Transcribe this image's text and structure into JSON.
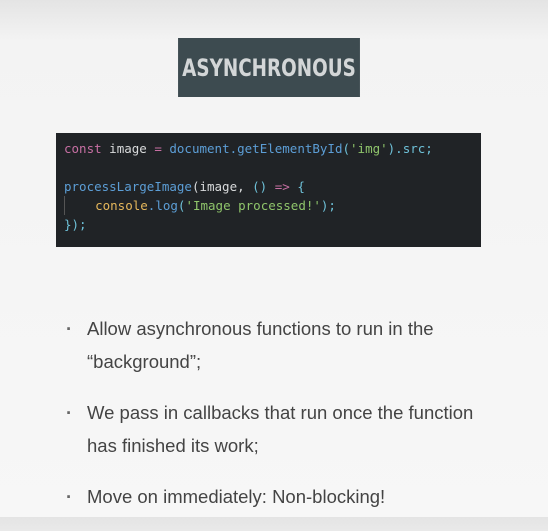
{
  "title": "ASYNCHRONOUS",
  "code": {
    "line1": {
      "kw": "const",
      "rest": " image ",
      "op": "=",
      "fn": " document.getElementById",
      "p1": "(",
      "str": "'img'",
      "p2": ").src;"
    },
    "line3": {
      "fn": "processLargeImage",
      "p1": "(image, ",
      "p2": "()",
      "op": " =>",
      "p3": " {"
    },
    "line4": {
      "obj": "console",
      "fn": ".log",
      "p1": "(",
      "str": "'Image processed!'",
      "p2": ");"
    },
    "line5": "});"
  },
  "bullets": [
    "Allow asynchronous functions to run in the “background”;",
    "We pass in callbacks that run once the function has finished its work;",
    "Move on immediately: Non-blocking!"
  ]
}
